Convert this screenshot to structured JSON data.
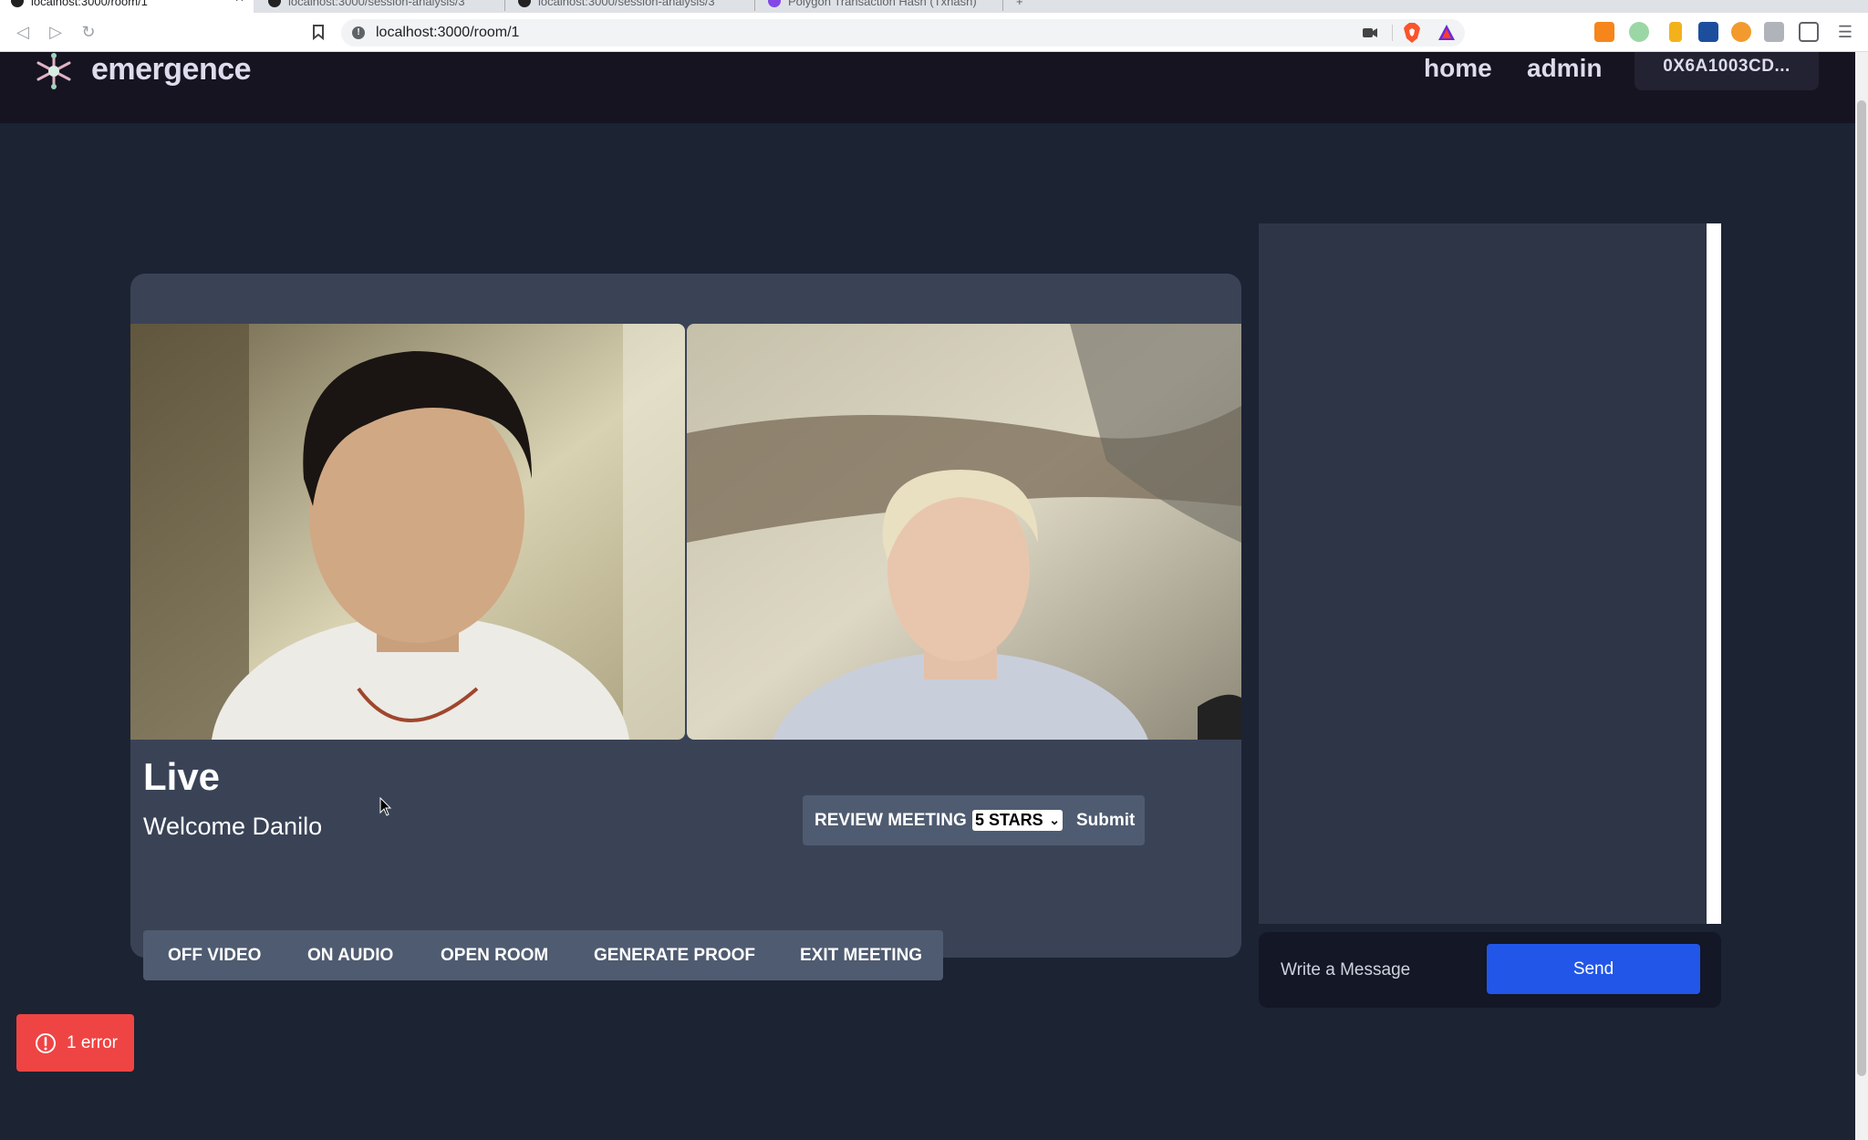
{
  "browser": {
    "tabs": [
      {
        "title": "localhost:3000/room/1",
        "active": true
      },
      {
        "title": "localhost:3000/session-analysis/3",
        "active": false
      },
      {
        "title": "localhost:3000/session-analysis/3",
        "active": false
      },
      {
        "title": "Polygon Transaction Hash (Txhash)",
        "active": false
      }
    ],
    "url": "localhost:3000/room/1"
  },
  "header": {
    "logo_text": "emergence",
    "nav": {
      "home": "home",
      "admin": "admin"
    },
    "wallet_address": "0X6A1003CD..."
  },
  "meeting": {
    "status": "Live",
    "welcome": "Welcome Danilo",
    "review": {
      "label": "REVIEW MEETING",
      "selected_rating": "5 STARS",
      "submit_label": "Submit"
    },
    "controls": {
      "video": "OFF VIDEO",
      "audio": "ON AUDIO",
      "room": "OPEN ROOM",
      "proof": "GENERATE PROOF",
      "exit": "EXIT MEETING"
    }
  },
  "chat": {
    "placeholder": "Write a Message",
    "send_label": "Send"
  },
  "error_badge": {
    "text": "1 error"
  },
  "colors": {
    "page_bg": "#1c2333",
    "header_bg": "#161421",
    "card_bg": "#3a4356",
    "control_bg": "#4f5b70",
    "send_blue": "#2156e8",
    "error_red": "#ef4444"
  }
}
